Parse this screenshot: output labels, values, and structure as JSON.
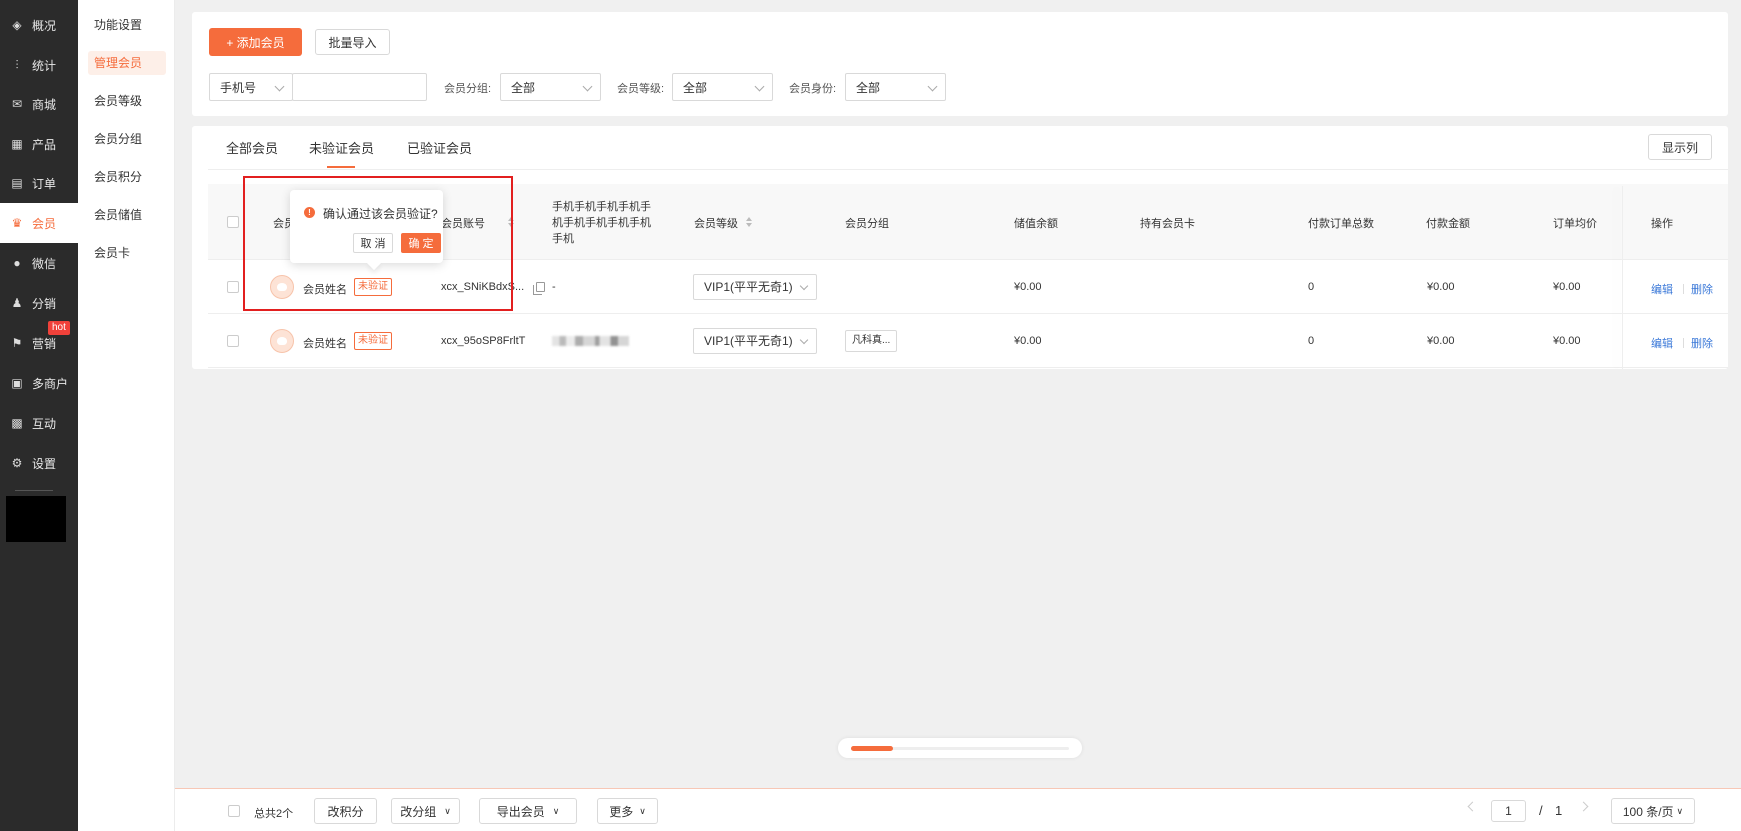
{
  "nav": {
    "items": [
      {
        "label": "概况",
        "icon": "layers-icon"
      },
      {
        "label": "统计",
        "icon": "chart-icon"
      },
      {
        "label": "商城",
        "icon": "mail-icon"
      },
      {
        "label": "产品",
        "icon": "grid-icon"
      },
      {
        "label": "订单",
        "icon": "clipboard-icon"
      },
      {
        "label": "会员",
        "icon": "crown-icon"
      },
      {
        "label": "微信",
        "icon": "wechat-icon"
      },
      {
        "label": "分销",
        "icon": "users-icon"
      },
      {
        "label": "营销",
        "icon": "flag-icon"
      },
      {
        "label": "多商户",
        "icon": "store-icon"
      },
      {
        "label": "互动",
        "icon": "interact-icon"
      },
      {
        "label": "设置",
        "icon": "gear-icon"
      }
    ],
    "hot_badge": "hot",
    "active_color": "#f56c3c"
  },
  "submenu": {
    "items": [
      "功能设置",
      "管理会员",
      "会员等级",
      "会员分组",
      "会员积分",
      "会员储值",
      "会员卡"
    ],
    "active": "管理会员"
  },
  "toolbar": {
    "add_label": "+ 添加会员",
    "import_label": "批量导入"
  },
  "filters": {
    "field_select": "手机号",
    "field_input_value": "",
    "group_label": "会员分组:",
    "group_value": "全部",
    "level_label": "会员等级:",
    "level_value": "全部",
    "identity_label": "会员身份:",
    "identity_value": "全部"
  },
  "tabs": [
    "全部会员",
    "未验证会员",
    "已验证会员"
  ],
  "active_tab": "未验证会员",
  "columns_button": "显示列",
  "table": {
    "headers": {
      "member": "会员",
      "account": "会员账号",
      "phone": "手机手机手机手机手机手机手机手机手机手机",
      "level": "会员等级",
      "group": "会员分组",
      "balance": "储值余额",
      "cards": "持有会员卡",
      "orders": "付款订单总数",
      "amount": "付款金额",
      "avg": "订单均价",
      "ops": "操作"
    },
    "rows": [
      {
        "name": "会员姓名",
        "status": "未验证",
        "account": "xcx_SNiKBdxS...",
        "phone": "-",
        "level": "VIP1(平平无奇1)",
        "group": "",
        "balance": "¥0.00",
        "cards": "",
        "orders": "0",
        "amount": "¥0.00",
        "avg": "¥0.00",
        "edit": "编辑",
        "delete": "删除"
      },
      {
        "name": "会员姓名",
        "status": "未验证",
        "account": "xcx_95oSP8FrltT",
        "phone": "",
        "level": "VIP1(平平无奇1)",
        "group": "凡科真...",
        "balance": "¥0.00",
        "cards": "",
        "orders": "0",
        "amount": "¥0.00",
        "avg": "¥0.00",
        "edit": "编辑",
        "delete": "删除"
      }
    ]
  },
  "popconfirm": {
    "message": "确认通过该会员验证?",
    "cancel": "取 消",
    "confirm": "确 定"
  },
  "bottom": {
    "total": "总共2个",
    "change_points": "改积分",
    "change_group": "改分组",
    "export": "导出会员",
    "more": "更多",
    "page_current": "1",
    "page_sep": "/",
    "page_total": "1",
    "page_size": "100 条/页"
  },
  "scroll_position": 0.19
}
